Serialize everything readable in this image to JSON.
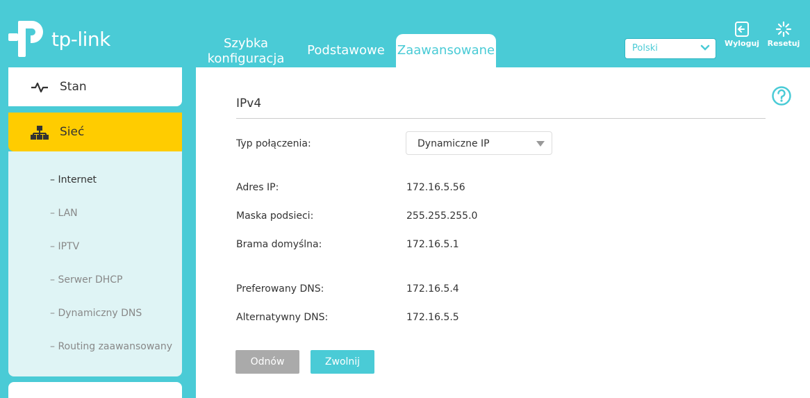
{
  "header": {
    "logo_text": "tp-link",
    "tabs": [
      {
        "label": "Szybka konfiguracja"
      },
      {
        "label": "Podstawowe"
      },
      {
        "label": "Zaawansowane"
      }
    ],
    "language": "Polski",
    "logout_label": "Wyloguj",
    "reset_label": "Resetuj"
  },
  "sidebar": {
    "stan_label": "Stan",
    "siec_label": "Sieć",
    "sub_items": [
      {
        "label": "– Internet"
      },
      {
        "label": "– LAN"
      },
      {
        "label": "– IPTV"
      },
      {
        "label": "– Serwer DHCP"
      },
      {
        "label": "– Dynamiczny DNS"
      },
      {
        "label": "– Routing zaawansowany"
      }
    ]
  },
  "main": {
    "section_title": "IPv4",
    "connection_type_label": "Typ połączenia:",
    "connection_type_value": "Dynamiczne IP",
    "fields": [
      {
        "label": "Adres IP:",
        "value": "172.16.5.56"
      },
      {
        "label": "Maska podsieci:",
        "value": "255.255.255.0"
      },
      {
        "label": "Brama domyślna:",
        "value": "172.16.5.1"
      },
      {
        "label": "Preferowany DNS:",
        "value": "172.16.5.4"
      },
      {
        "label": "Alternatywny DNS:",
        "value": "172.16.5.5"
      }
    ],
    "renew_label": "Odnów",
    "release_label": "Zwolnij"
  },
  "colors": {
    "accent": "#4acbd6",
    "active_nav": "#ffcc00",
    "submenu_bg": "#dff4f5"
  }
}
